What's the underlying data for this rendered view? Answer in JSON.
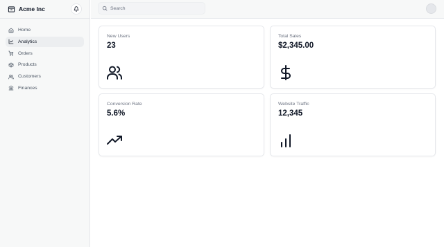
{
  "brand": {
    "name": "Acme Inc",
    "icon": "package-icon"
  },
  "notifications": {
    "icon": "bell-icon"
  },
  "nav": {
    "items": [
      {
        "label": "Home",
        "icon": "home-icon",
        "active": false
      },
      {
        "label": "Analytics",
        "icon": "line-chart-icon",
        "active": true
      },
      {
        "label": "Orders",
        "icon": "shopping-cart-icon",
        "active": false
      },
      {
        "label": "Products",
        "icon": "package-icon",
        "active": false
      },
      {
        "label": "Customers",
        "icon": "users-icon",
        "active": false
      },
      {
        "label": "Finances",
        "icon": "bank-icon",
        "active": false
      }
    ]
  },
  "search": {
    "placeholder": "Search",
    "icon": "search-icon"
  },
  "cards": [
    {
      "label": "New Users",
      "value": "23",
      "icon": "users-icon"
    },
    {
      "label": "Total Sales",
      "value": "$2,345.00",
      "icon": "dollar-sign-icon"
    },
    {
      "label": "Conversion Rate",
      "value": "5.6%",
      "icon": "trending-up-icon"
    },
    {
      "label": "Website Traffic",
      "value": "12,345",
      "icon": "bar-chart-icon"
    }
  ],
  "colors": {
    "sidebar_bg": "#f7f8f8",
    "active_nav_bg": "#eceef0",
    "border": "#e5e7eb",
    "text_primary": "#111827",
    "text_muted": "#6b7280"
  }
}
